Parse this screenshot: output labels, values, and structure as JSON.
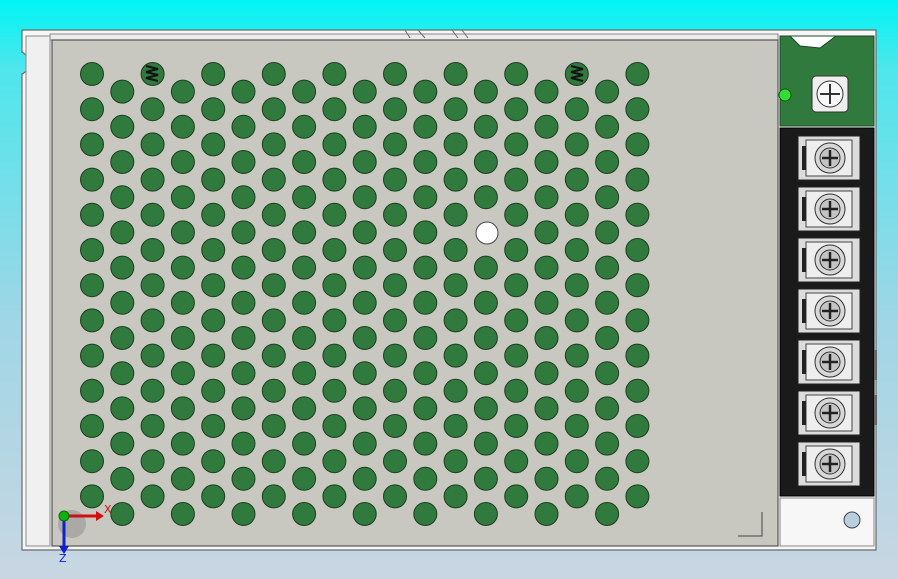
{
  "viewport": {
    "background_top": "#00f5f5",
    "background_bottom": "#c9d6e2"
  },
  "model": {
    "chassis_color": "#c8c8c0",
    "vent_hole_color": "#2f7a3c",
    "pcb_color": "#2f7a3c",
    "terminal_block_color": "#1a1a1a",
    "terminal_count": 7,
    "vent_grid": {
      "columns": 19,
      "rows": 13,
      "staggered": true
    },
    "indicator_led_color": "#33dd33"
  },
  "triad": {
    "x_label": "X",
    "z_label": "Z",
    "x_color": "#d01010",
    "y_color": "#10b010",
    "z_color": "#1020d0"
  }
}
